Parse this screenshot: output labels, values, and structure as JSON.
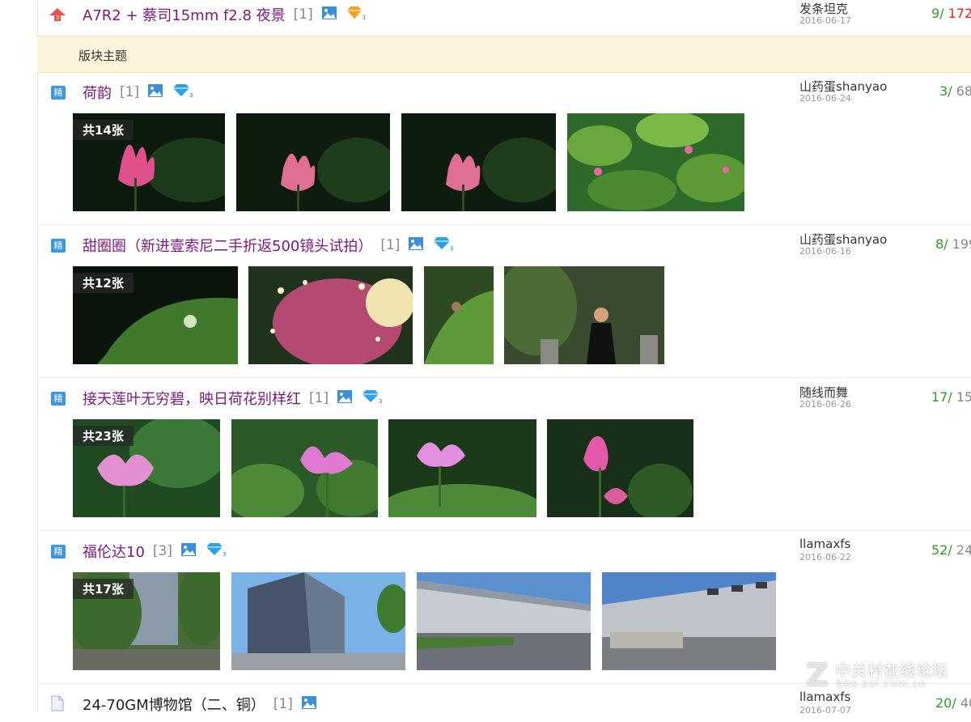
{
  "threads": [
    {
      "title": "A7R2 + 蔡司15mm f2.8 夜景",
      "count": "[1]",
      "author": "发条坦克",
      "date": "2016-06-17",
      "replies": "9",
      "views": "172",
      "icon": "hot-up-icon"
    },
    {
      "title": "荷韵",
      "count": "[1]",
      "author": "山药蛋shanyao",
      "date": "2016-06-24",
      "replies": "3",
      "views": "68",
      "badge": "精",
      "photo_count": "共14张"
    },
    {
      "title": "甜圈圈（新进壹索尼二手折返500镜头试拍）",
      "count": "[1]",
      "author": "山药蛋shanyao",
      "date": "2016-06-16",
      "replies": "8",
      "views": "199",
      "badge": "精",
      "photo_count": "共12张"
    },
    {
      "title": "接天莲叶无穷碧，映日荷花别样红",
      "count": "[1]",
      "author": "随线而舞",
      "date": "2016-06-26",
      "replies": "17",
      "views": "15",
      "badge": "精",
      "photo_count": "共23张"
    },
    {
      "title": "福伦达10",
      "count": "[3]",
      "author": "llamaxfs",
      "date": "2016-06-22",
      "replies": "52",
      "views": "24",
      "badge": "精",
      "photo_count": "共17张"
    },
    {
      "title": "24-70GM博物馆（二、铜）",
      "count": "[1]",
      "author": "llamaxfs",
      "date": "2016-07-07",
      "replies": "20",
      "views": "40"
    }
  ],
  "section_label": "版块主题",
  "separator": "/",
  "watermark": {
    "line1": "中关村在线论坛",
    "line2": "bbs.zol.com.cn"
  },
  "colors": {
    "title": "#7a1a7e",
    "badge": "#3f96e0",
    "replies": "#2e9b2e",
    "hot_views": "#e0272a",
    "section_bg": "#fdf4dc"
  }
}
